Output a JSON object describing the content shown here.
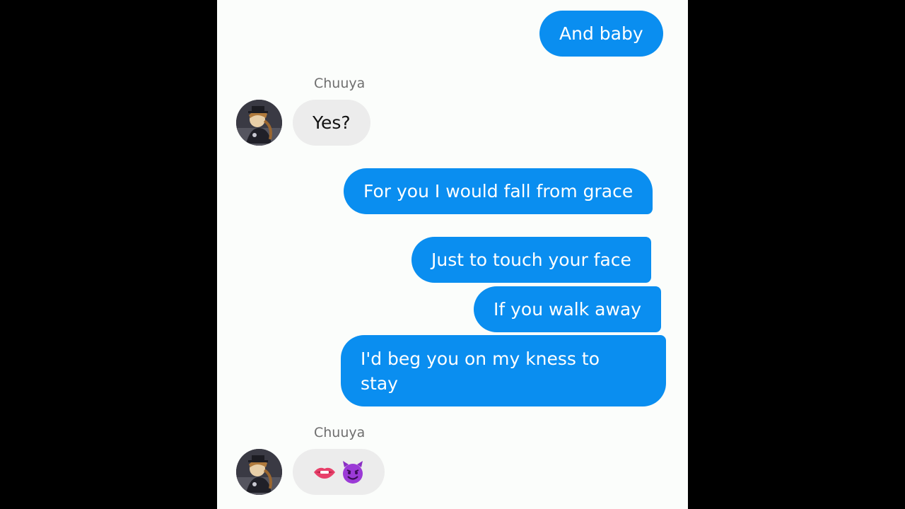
{
  "contact": {
    "name": "Chuuya"
  },
  "messages": [
    {
      "direction": "out",
      "text": "And baby"
    },
    {
      "direction": "in",
      "sender": "Chuuya",
      "text": "Yes?"
    },
    {
      "direction": "out",
      "text": "For you I would fall from grace"
    },
    {
      "direction": "out",
      "text": "Just to touch your face"
    },
    {
      "direction": "out",
      "text": "If you walk away"
    },
    {
      "direction": "out",
      "text_line1": "I'd beg you on my kness to",
      "text_line2": "stay"
    },
    {
      "direction": "in",
      "sender": "Chuuya",
      "emoji": [
        "biting-lip",
        "smiling-devil"
      ]
    }
  ],
  "colors": {
    "outgoing_bubble": "#0a8ef0",
    "incoming_bubble": "#ececec",
    "background": "#fbfdfb",
    "letterbox": "#000000"
  }
}
